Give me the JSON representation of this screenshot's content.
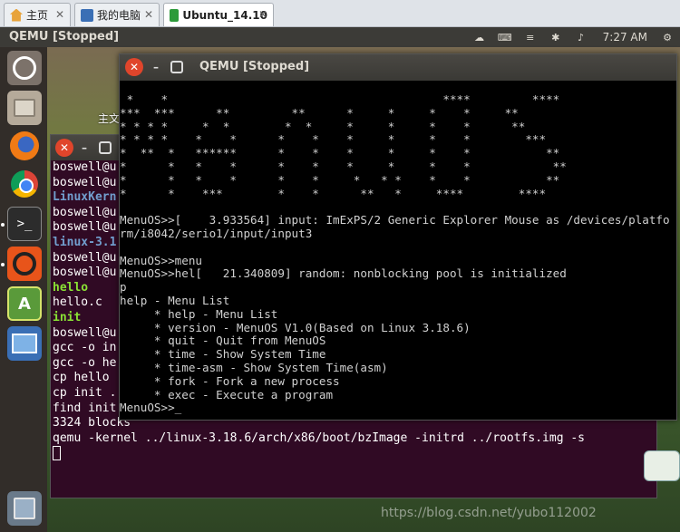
{
  "host_tabs": [
    {
      "label": "主页",
      "icon": "home-icon"
    },
    {
      "label": "我的电脑",
      "icon": "computer-icon"
    },
    {
      "label": "Ubuntu_14.10",
      "icon": "vm-icon"
    }
  ],
  "top_panel": {
    "title": "QEMU [Stopped]",
    "time": "7:27 AM"
  },
  "desktop": {
    "label": "主文"
  },
  "background_terminal": {
    "lines": [
      {
        "text": "boswell@u",
        "style": "normal"
      },
      {
        "text": "boswell@u",
        "style": "normal"
      },
      {
        "text": "LinuxKern",
        "style": "blue"
      },
      {
        "text": "boswell@u",
        "style": "normal"
      },
      {
        "text": "boswell@u",
        "style": "normal"
      },
      {
        "text": "linux-3.1",
        "style": "blue"
      },
      {
        "text": "boswell@u",
        "style": "normal"
      },
      {
        "text": "boswell@u",
        "style": "normal"
      },
      {
        "text": "hello",
        "style": "green"
      },
      {
        "text": "hello.c",
        "style": "normal"
      },
      {
        "text": "init",
        "style": "green"
      },
      {
        "text": "boswell@u",
        "style": "normal"
      },
      {
        "text": "gcc -o in",
        "style": "normal"
      },
      {
        "text": "gcc -o he",
        "style": "normal"
      },
      {
        "text": "cp hello",
        "style": "normal"
      },
      {
        "text": "cp init .",
        "style": "normal"
      },
      {
        "text": "find init",
        "style": "normal"
      },
      {
        "text": "3324 blocks",
        "style": "normal"
      },
      {
        "text": "qemu -kernel ../linux-3.18.6/arch/x86/boot/bzImage -initrd ../rootfs.img -s",
        "style": "normal"
      }
    ]
  },
  "qemu_window": {
    "title": "QEMU [Stopped]",
    "console_lines": [
      " *    *                                        ****         ****",
      "***  ***      **         **      *     *     *    *     **",
      "* * * *     *  *        *  *     *     *     *    *      **",
      "* * * *    *    *      *    *    *     *     *    *        ***",
      "*  **  *   ******      *    *    *     *     *    *           **",
      "*      *   *    *      *    *    *     *     *    *            **",
      "*      *   *    *      *    *     *   * *    *    *           **",
      "*      *    ***        *    *      **   *     ****        ****",
      "",
      "MenuOS>>[    3.933564] input: ImExPS/2 Generic Explorer Mouse as /devices/platfo",
      "rm/i8042/serio1/input/input3",
      "",
      "MenuOS>>menu",
      "MenuOS>>hel[   21.340809] random: nonblocking pool is initialized",
      "p",
      "help - Menu List",
      "     * help - Menu List",
      "     * version - MenuOS V1.0(Based on Linux 3.18.6)",
      "     * quit - Quit from MenuOS",
      "     * time - Show System Time",
      "     * time-asm - Show System Time(asm)",
      "     * fork - Fork a new process",
      "     * exec - Execute a program",
      "MenuOS>>_"
    ]
  },
  "watermark": "https://blog.csdn.net/yubo112002"
}
